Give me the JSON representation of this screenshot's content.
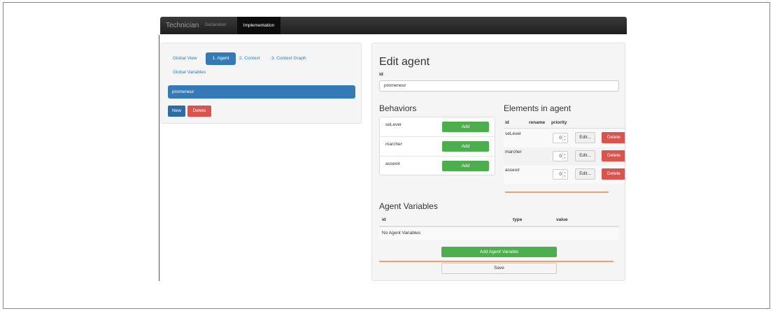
{
  "navbar": {
    "brand": "Technician",
    "links": [
      "Declaration"
    ],
    "active": "Implementation"
  },
  "left": {
    "tabs": [
      "Global View",
      "1. Agent",
      "2. Context",
      "3. Context Graph",
      "Global Variables"
    ],
    "active_tab": "1. Agent",
    "agents": [
      "promeneur"
    ],
    "new_label": "New",
    "delete_label": "Delete"
  },
  "edit": {
    "title": "Edit agent",
    "id_label": "id",
    "id_value": "promeneur"
  },
  "behaviors": {
    "title": "Behaviors",
    "add_label": "Add",
    "items": [
      "seLever",
      "marcher",
      "asseoir"
    ]
  },
  "elements": {
    "title": "Elements in agent",
    "headers": [
      "id",
      "rename",
      "priority"
    ],
    "edit_label": "Edit...",
    "delete_label": "Delete",
    "rows": [
      {
        "id": "seLever",
        "priority": "0"
      },
      {
        "id": "marcher",
        "priority": "0"
      },
      {
        "id": "asseoir",
        "priority": "0"
      }
    ]
  },
  "variables": {
    "title": "Agent Variables",
    "headers": [
      "id",
      "type",
      "value"
    ],
    "empty": "No Agent Variables",
    "add_label": "Add Agent Variable",
    "save_label": "Save"
  },
  "colors": {
    "primary": "#337ab7",
    "success": "#4cae4c",
    "danger": "#d9534f",
    "navbar": "#222222",
    "accent_line": "#f0a070"
  }
}
